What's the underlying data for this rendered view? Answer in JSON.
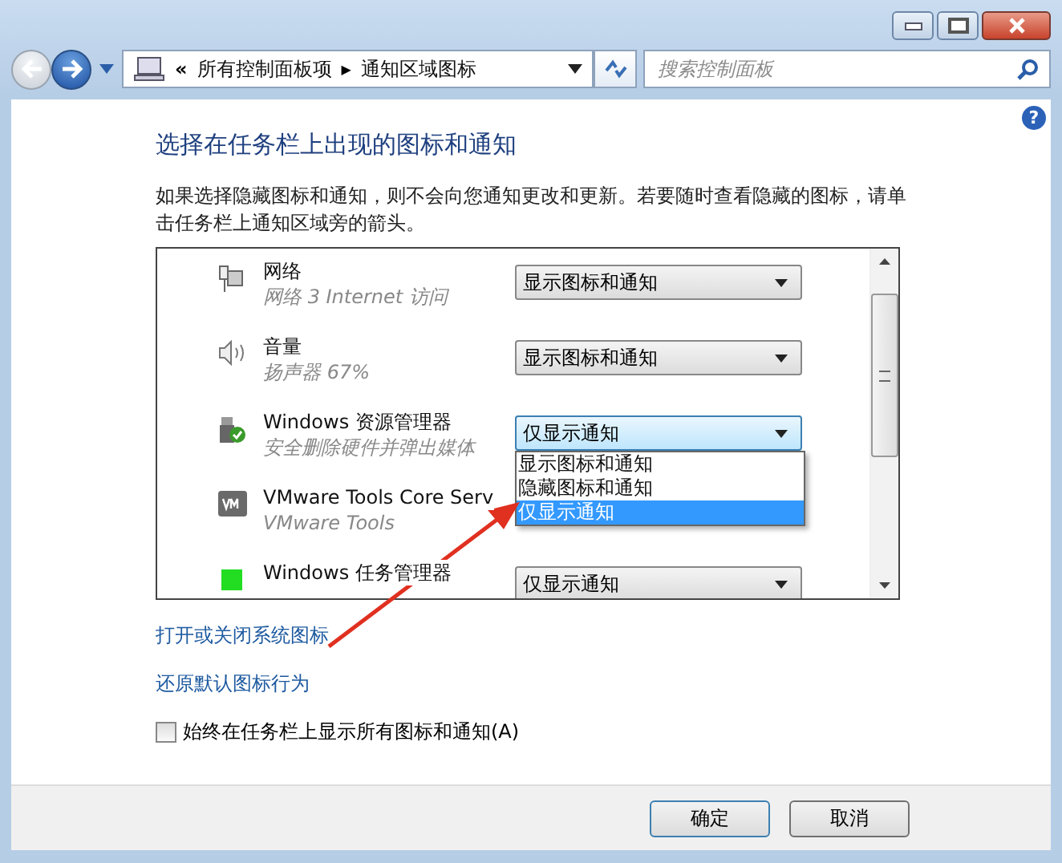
{
  "nav": {
    "back_disabled": true,
    "forward_disabled": false
  },
  "address": {
    "prefix": "«",
    "crumbs": [
      "所有控制面板项",
      "通知区域图标"
    ],
    "separator": "▶"
  },
  "search": {
    "placeholder": "搜索控制面板"
  },
  "help": "?",
  "heading": "选择在任务栏上出现的图标和通知",
  "description": "如果选择隐藏图标和通知，则不会向您通知更改和更新。若要随时查看隐藏的图标，请单击任务栏上通知区域旁的箭头。",
  "items": [
    {
      "kind": "network",
      "name": "网络",
      "detail": "网络 3 Internet 访问",
      "behavior": "显示图标和通知",
      "focused": false
    },
    {
      "kind": "speaker",
      "name": "音量",
      "detail": "扬声器 67%",
      "behavior": "显示图标和通知",
      "focused": false
    },
    {
      "kind": "usb",
      "name": "Windows 资源管理器",
      "detail": "安全删除硬件并弹出媒体",
      "behavior": "仅显示通知",
      "focused": true
    },
    {
      "kind": "vm",
      "name": "VMware Tools Core Serv",
      "detail": "VMware Tools"
    },
    {
      "kind": "task",
      "name": "Windows 任务管理器",
      "behavior": "仅显示通知",
      "focused": false
    }
  ],
  "dropdown": {
    "options": [
      {
        "label": "显示图标和通知",
        "selected": false
      },
      {
        "label": "隐藏图标和通知",
        "selected": false
      },
      {
        "label": "仅显示通知",
        "selected": true
      }
    ]
  },
  "links": [
    "打开或关闭系统图标",
    "还原默认图标行为"
  ],
  "always_show": {
    "label": "始终在任务栏上显示所有图标和通知(A)",
    "checked": false
  },
  "buttons": [
    "确定",
    "取消"
  ]
}
